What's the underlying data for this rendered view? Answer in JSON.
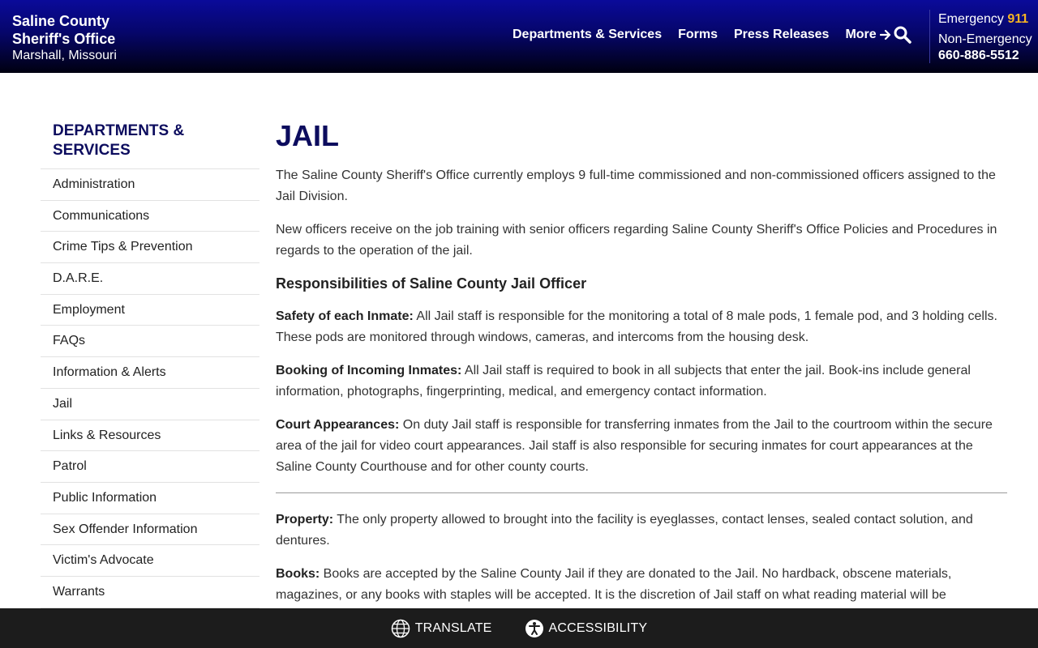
{
  "header": {
    "brand_line1": "Saline County",
    "brand_line2": "Sheriff's Office",
    "brand_line3": "Marshall, Missouri",
    "nav": [
      "Departments & Services",
      "Forms",
      "Press Releases"
    ],
    "more_label": "More",
    "emergency_label": "Emergency",
    "emergency_number": "911",
    "nonemergency_label": "Non-Emergency",
    "nonemergency_number": "660-886-5512",
    "icons": {
      "search": "search-icon",
      "more": "arrow-right-icon"
    }
  },
  "sidebar": {
    "title": "Departments & Services",
    "items": [
      "Administration",
      "Communications",
      "Crime Tips & Prevention",
      "D.A.R.E.",
      "Employment",
      "FAQs",
      "Information & Alerts",
      "Jail",
      "Links & Resources",
      "Patrol",
      "Public Information",
      "Sex Offender Information",
      "Victim's Advocate",
      "Warrants"
    ]
  },
  "main": {
    "title": "JAIL",
    "intro1": "The Saline County Sheriff's Office currently employs 9 full-time commissioned and non-commissioned officers assigned to the Jail Division.",
    "intro2": "New officers receive on the job training with senior officers regarding Saline County Sheriff's Office Policies and Procedures in regards to the operation of the jail.",
    "subhead": "Responsibilities of Saline County Jail Officer",
    "safety_label": "Safety of each Inmate:",
    "safety_text": " All Jail staff is responsible for the monitoring a total of 8 male pods, 1 female pod, and 3 holding cells. These pods are monitored through windows, cameras, and intercoms from the housing desk.",
    "booking_label": "Booking of Incoming Inmates:",
    "booking_text": " All Jail staff is required to book in all subjects that enter the jail. Book-ins include general information, photographs, fingerprinting, medical, and emergency contact information.",
    "court_label": "Court Appearances:",
    "court_text": " On duty Jail staff is responsible for transferring inmates from the Jail to the courtroom within the secure area of the jail for video court appearances. Jail staff is also responsible for securing inmates for court appearances at the Saline County Courthouse and for other county courts.",
    "property_label": "Property:",
    "property_text": " The only property allowed to brought into the facility is eyeglasses, contact lenses, sealed contact solution, and dentures.",
    "books_label": "Books:",
    "books_text": " Books are accepted by the Saline County Jail if they are donated to the Jail. No hardback, obscene materials, magazines, or any books with staples will be accepted. It is the discretion of Jail staff on what reading material will be"
  },
  "footer": {
    "translate_label": "TRANSLATE",
    "accessibility_label": "ACCESSIBILITY",
    "icons": {
      "translate": "globe-icon",
      "accessibility": "accessibility-icon"
    }
  },
  "colors": {
    "header_top": "#0a0a9a",
    "header_bottom": "#000010",
    "emergency_accent": "#f5b324",
    "title_navy": "#0c0c5e",
    "footer_bg": "#1c1c1c"
  }
}
